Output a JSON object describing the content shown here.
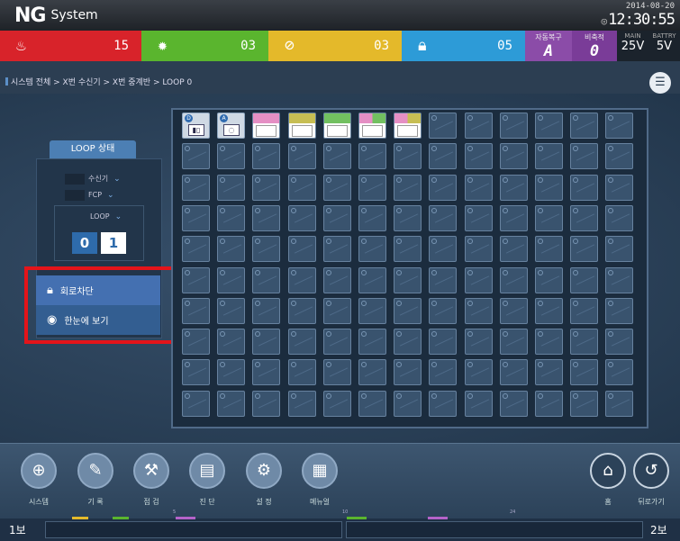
{
  "header": {
    "logo_mark": "NG",
    "logo_text": "System",
    "date": "2014-08-20",
    "time": "12:30:55"
  },
  "status": {
    "fire_count": "15",
    "supervisory_count": "03",
    "trouble_count": "03",
    "lock_count": "05",
    "auto_recovery_label": "자동복구",
    "auto_recovery_value": "A",
    "silent_label": "비축적",
    "silent_value": "0",
    "main_label": "MAIN",
    "main_value": "25V",
    "battery_label": "BATTRY",
    "battery_value": "5V",
    "colors": {
      "fire": "#d8232a",
      "supervisory": "#5ab52e",
      "trouble": "#e4b92a",
      "lock": "#2d9bd7",
      "auto": "#8b4ca8"
    }
  },
  "breadcrumb": "시스템 전체 > X번 수신기 > X번 중계반 > LOOP 0",
  "loop_panel": {
    "title": "LOOP 상태",
    "receiver_label": "수신기",
    "fcp_label": "FCP",
    "loop_label": "LOOP",
    "digit_0": "0",
    "digit_1": "1"
  },
  "menu": {
    "circuit_block": "회로차단",
    "overview": "한눈에 보기"
  },
  "grid": {
    "columns": 13,
    "rows": 10,
    "devices": [
      {
        "type": "device",
        "badge": "D",
        "icon": "detector-icon"
      },
      {
        "type": "device",
        "badge": "A",
        "icon": "alarm-icon"
      },
      {
        "type": "color",
        "band": "#e58fc4"
      },
      {
        "type": "color",
        "band": "#c7be53"
      },
      {
        "type": "color",
        "band": "#72c060"
      },
      {
        "type": "color",
        "band": "#e58fc4",
        "band2": "#72c060"
      },
      {
        "type": "color",
        "band": "#e58fc4",
        "band2": "#c7be53"
      }
    ]
  },
  "toolbar": {
    "system": "시스템",
    "record": "기 록",
    "inspect": "점 검",
    "diagnose": "진 단",
    "settings": "설 정",
    "manual": "메뉴얼",
    "home": "홈",
    "back": "뒤로가기"
  },
  "footer": {
    "left_label": "1보",
    "right_label": "2보",
    "tick_labels": [
      "5",
      "10",
      "24"
    ]
  }
}
